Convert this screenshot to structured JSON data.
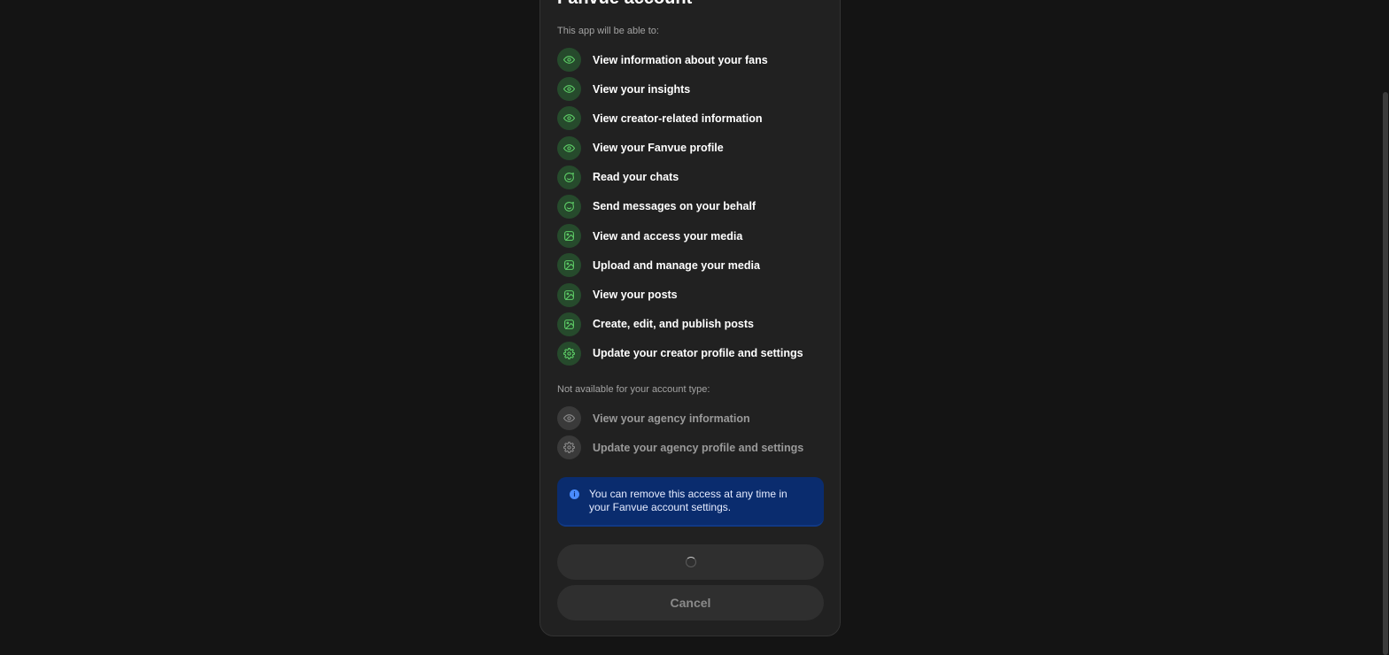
{
  "modal": {
    "title": "Fanvue account",
    "able_label": "This app will be able to:",
    "unavailable_label": "Not available for your account type:",
    "permissions": [
      {
        "label": "View information about your fans",
        "icon": "eye-icon"
      },
      {
        "label": "View your insights",
        "icon": "eye-icon"
      },
      {
        "label": "View creator-related information",
        "icon": "eye-icon"
      },
      {
        "label": "View your Fanvue profile",
        "icon": "eye-icon"
      },
      {
        "label": "Read your chats",
        "icon": "chat-icon"
      },
      {
        "label": "Send messages on your behalf",
        "icon": "chat-icon"
      },
      {
        "label": "View and access your media",
        "icon": "image-icon"
      },
      {
        "label": "Upload and manage your media",
        "icon": "image-icon"
      },
      {
        "label": "View your posts",
        "icon": "image-icon"
      },
      {
        "label": "Create, edit, and publish posts",
        "icon": "image-icon"
      },
      {
        "label": "Update your creator profile and settings",
        "icon": "gear-icon"
      }
    ],
    "unavailable": [
      {
        "label": "View your agency information",
        "icon": "eye-icon"
      },
      {
        "label": "Update your agency profile and settings",
        "icon": "gear-icon"
      }
    ],
    "info": {
      "icon": "info-icon",
      "text": "You can remove this access at any time in your Fanvue account settings."
    },
    "buttons": {
      "primary_state": "loading",
      "cancel_label": "Cancel"
    }
  },
  "colors": {
    "background": "#141414",
    "modal": "#212121",
    "permission_icon_bg": "#264a2c",
    "permission_icon_fg": "#5fd068",
    "info_bg": "#0a2c6e",
    "button_bg": "#2f2f2f"
  }
}
